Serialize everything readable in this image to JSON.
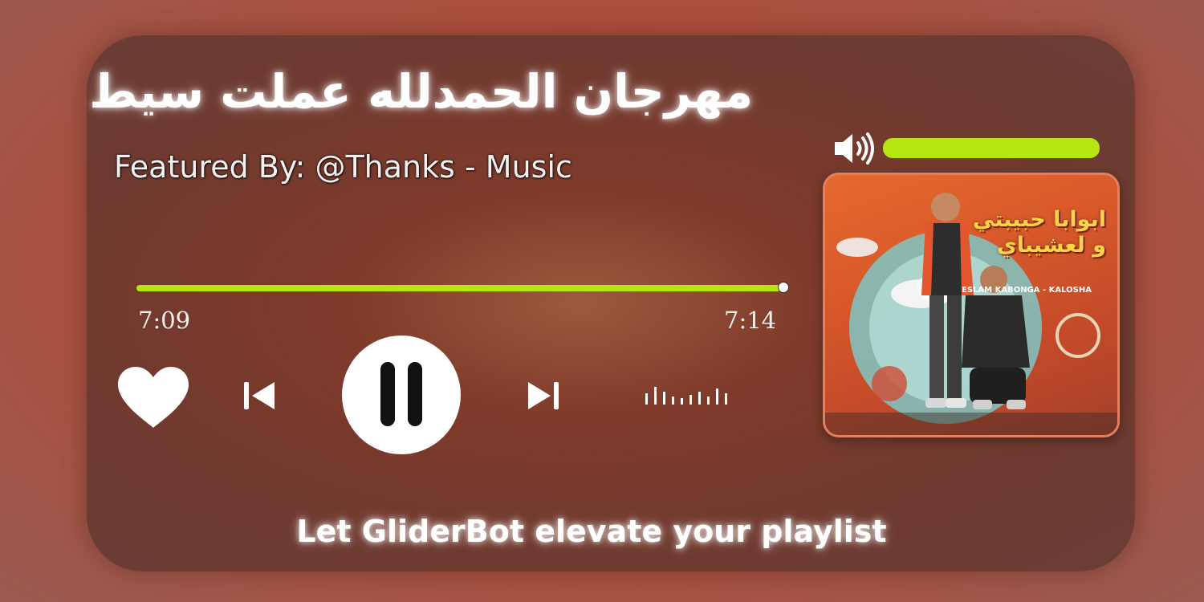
{
  "track": {
    "title": "مهرجان الحمدلله عملت سيط",
    "featured": "Featured By: @Thanks - Music"
  },
  "playback": {
    "elapsed": "7:09",
    "duration": "7:14",
    "progress_fraction": 0.99
  },
  "volume": {
    "level_fraction": 1.0
  },
  "controls": {
    "like_icon": "heart-icon",
    "previous_icon": "skip-previous-icon",
    "pause_icon": "pause-icon",
    "next_icon": "skip-next-icon",
    "equalizer_icon": "equalizer-icon",
    "volume_icon": "speaker-icon"
  },
  "album_art": {
    "artwork_title": "ابوابا حبيبتي و لعشيباي",
    "artists": "ESLAM KABONGA - KALOSHA"
  },
  "footer": {
    "tagline": "Let GliderBot elevate your playlist"
  },
  "colors": {
    "accent": "#b6e512",
    "text": "#ffffff"
  }
}
